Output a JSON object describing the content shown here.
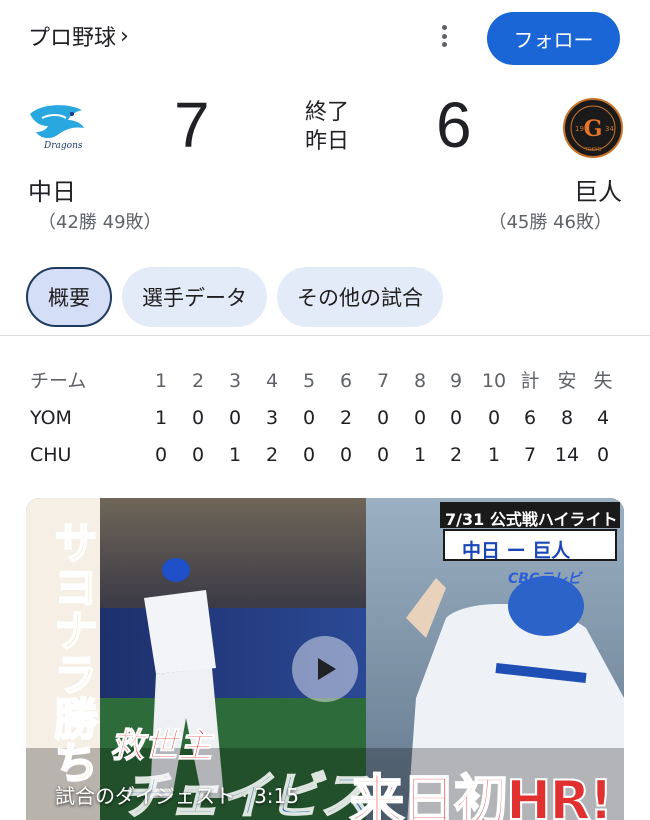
{
  "header": {
    "breadcrumb": "プロ野球",
    "breadcrumb_chevron": "›",
    "follow_label": "フォロー"
  },
  "game": {
    "status_line1": "終了",
    "status_line2": "昨日",
    "home": {
      "name": "中日",
      "score": "7",
      "record": "（42勝 49敗）",
      "logo": "dragons-logo"
    },
    "away": {
      "name": "巨人",
      "score": "6",
      "record": "（45勝 46敗）",
      "logo": "giants-logo"
    }
  },
  "tabs": [
    {
      "label": "概要",
      "active": true
    },
    {
      "label": "選手データ",
      "active": false
    },
    {
      "label": "その他の試合",
      "active": false
    }
  ],
  "linescore": {
    "header": [
      "チーム",
      "1",
      "2",
      "3",
      "4",
      "5",
      "6",
      "7",
      "8",
      "9",
      "10",
      "計",
      "安",
      "失"
    ],
    "rows": [
      [
        "YOM",
        "1",
        "0",
        "0",
        "3",
        "0",
        "2",
        "0",
        "0",
        "0",
        "0",
        "6",
        "8",
        "4"
      ],
      [
        "CHU",
        "0",
        "0",
        "1",
        "2",
        "0",
        "0",
        "0",
        "1",
        "2",
        "1",
        "7",
        "14",
        "0"
      ]
    ]
  },
  "video": {
    "caption": "試合のダイジェスト · 3:15",
    "thumb_date": "7/31 公式戦ハイライト",
    "thumb_teams": "中日 ー 巨人",
    "thumb_network": "CBCテレビ",
    "thumb_side": "サヨナラ勝ち",
    "thumb_bottom1": "救世主",
    "thumb_bottom2": "来日初HR!",
    "thumb_bottom3": "チェイビス",
    "play_icon": "play-icon"
  },
  "colors": {
    "follow_bg": "#1a66d6",
    "tab_bg": "#e3eaf8",
    "active_tab_border": "#1f3a5f"
  }
}
